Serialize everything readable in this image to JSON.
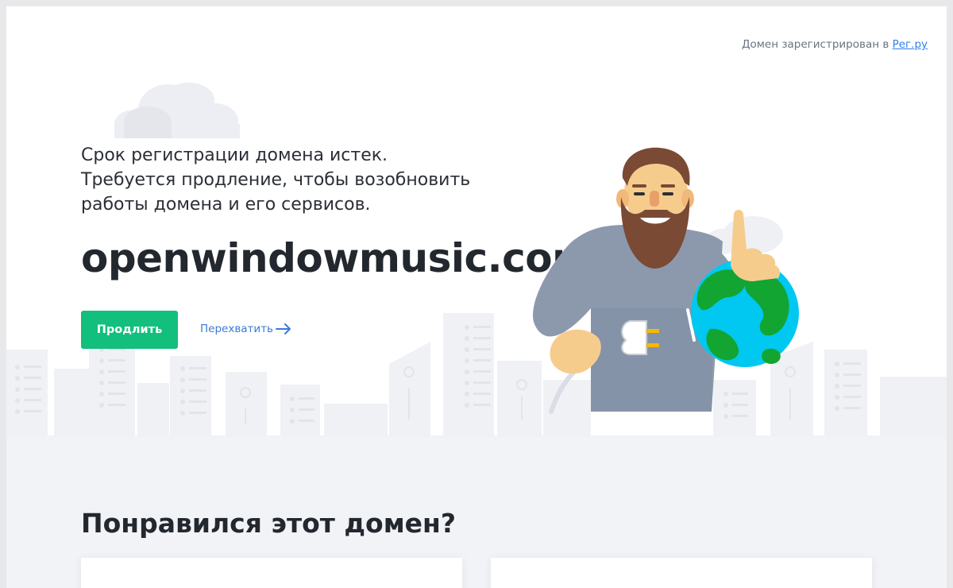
{
  "registrar": {
    "text": "Домен зарегистрирован в",
    "link": "Рег.ру"
  },
  "message": {
    "line1": "Срок регистрации домена истек.",
    "line2": "Требуется продление, чтобы возобновить",
    "line3": "работы домена и его сервисов."
  },
  "domain": {
    "name": "openwindowmusic.com"
  },
  "actions": {
    "renew_label": "Продлить",
    "intercept_label": "Перехватить"
  },
  "section": {
    "title": "Понравился этот домен?"
  },
  "colors": {
    "accent_green": "#12bf7c",
    "link_blue": "#3b7ad9"
  }
}
